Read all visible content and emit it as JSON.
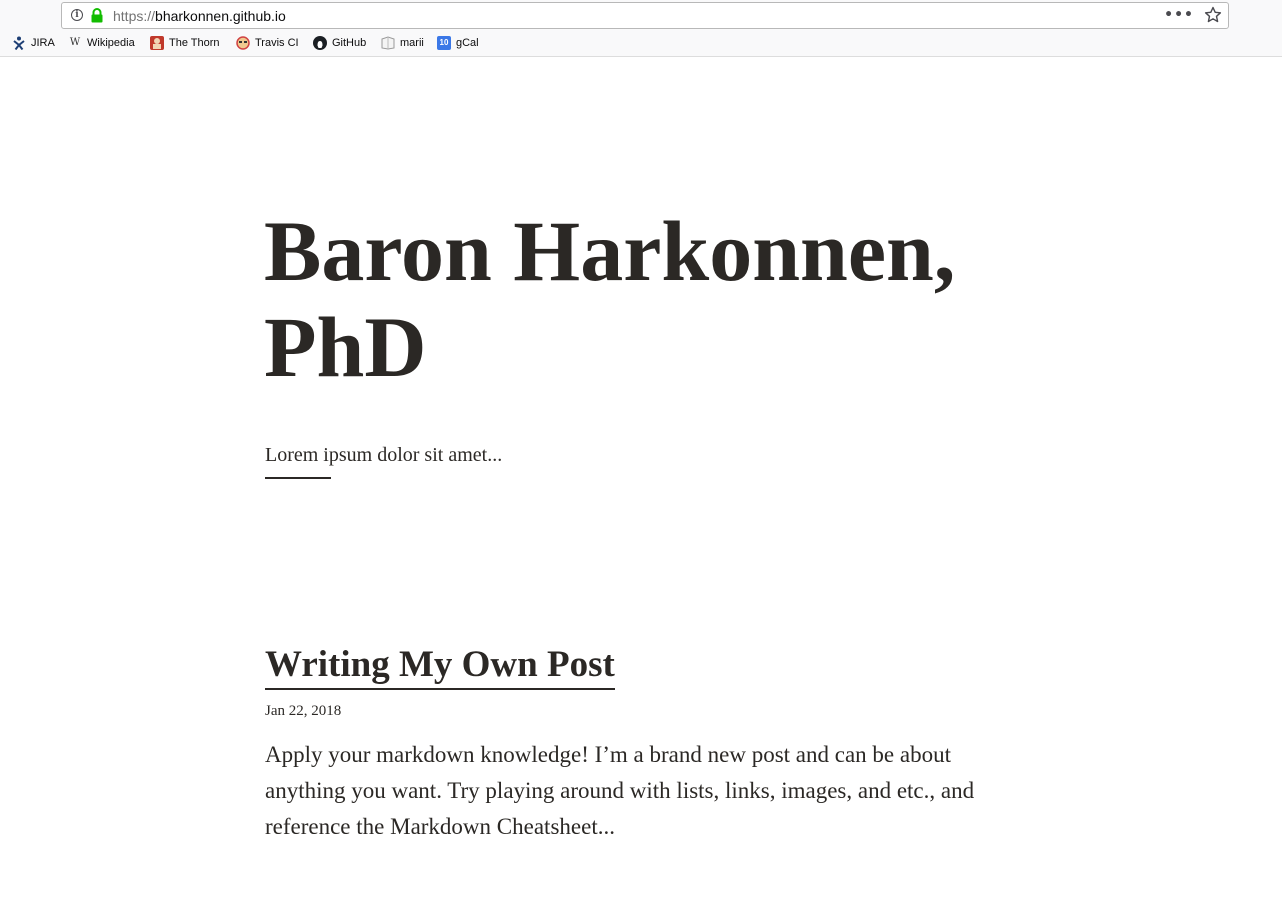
{
  "browser": {
    "url_scheme": "https://",
    "url_host": "bharkonnen.github.io",
    "bookmarks": [
      {
        "label": "JIRA",
        "icon": "jira-icon"
      },
      {
        "label": "Wikipedia",
        "icon": "wikipedia-icon"
      },
      {
        "label": "The Thorn",
        "icon": "the-thorn-icon"
      },
      {
        "label": "Travis CI",
        "icon": "travis-ci-icon"
      },
      {
        "label": "GitHub",
        "icon": "github-icon"
      },
      {
        "label": "marii",
        "icon": "marii-icon"
      },
      {
        "label": "gCal",
        "icon": "gcal-icon"
      }
    ],
    "gcal_badge": "10",
    "wiki_glyph": "W",
    "more_glyph": "•••",
    "info_glyph": "i"
  },
  "site": {
    "title": "Baron Harkonnen, PhD",
    "tagline": "Lorem ipsum dolor sit amet..."
  },
  "posts": [
    {
      "title": "Writing My Own Post",
      "date": "Jan 22, 2018",
      "excerpt": "Apply your markdown knowledge! I’m a brand new post and can be about anything you want. Try playing around with lists, links, images, and etc., and reference the Markdown Cheatsheet..."
    }
  ],
  "colors": {
    "text": "#2b2825",
    "lock": "#12bc00",
    "chrome_bg": "#f9f9fa"
  }
}
